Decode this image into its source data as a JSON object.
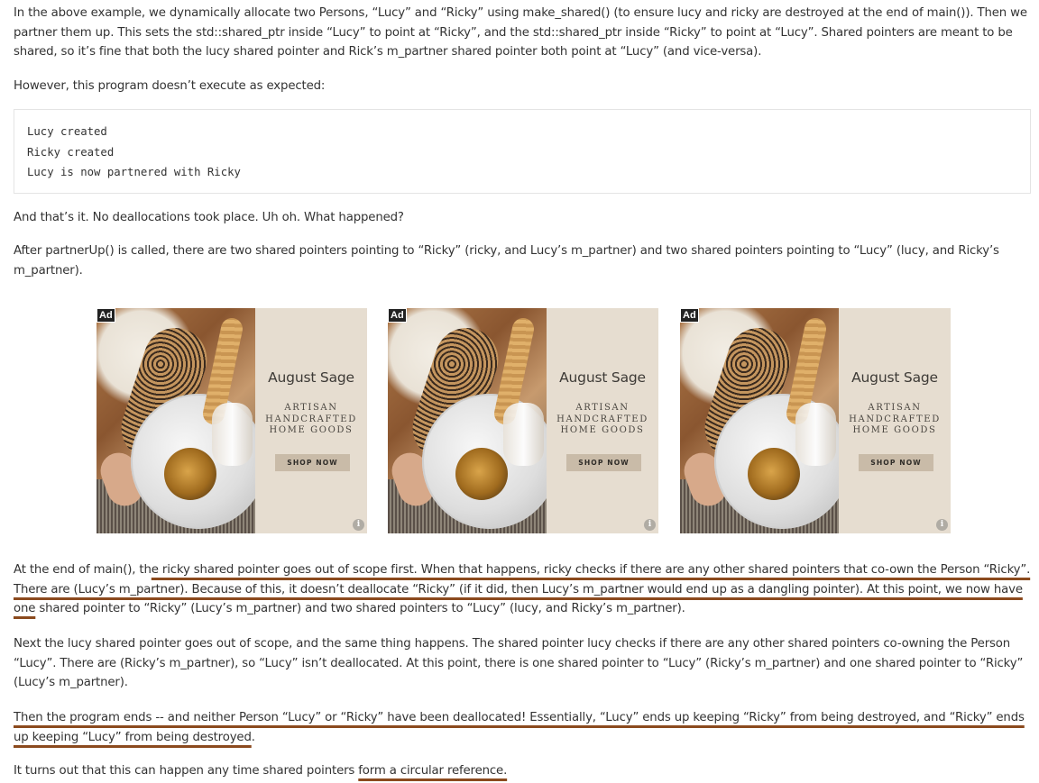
{
  "paragraphs": {
    "p1": "In the above example, we dynamically allocate two Persons, “Lucy” and “Ricky” using make_shared() (to ensure lucy and ricky are destroyed at the end of main()). Then we partner them up. This sets the std::shared_ptr inside “Lucy” to point at “Ricky”, and the std::shared_ptr inside “Ricky” to point at “Lucy”. Shared pointers are meant to be shared, so it’s fine that both the lucy shared pointer and Rick’s m_partner shared pointer both point at “Lucy” (and vice-versa).",
    "p2": "However, this program doesn’t execute as expected:",
    "p3": "And that’s it. No deallocations took place. Uh oh. What happened?",
    "p4": "After partnerUp() is called, there are two shared pointers pointing to “Ricky” (ricky, and Lucy’s m_partner) and two shared pointers pointing to “Lucy” (lucy, and Ricky’s m_partner).",
    "p5_a": "At the end of main(), th",
    "p5_b": "e ricky shared pointer goes out of scope first. When that happens, ricky checks if there are any other shared pointers that co-own the Person “Ricky”. There are (Lucy’s m_partner). Because of this, it doesn’t deallocate “Ricky” (if it did, then Lucy’s m_partner would end up as a dangling pointer). At this point, we now have one",
    "p5_c": " shared pointer to “Ricky” (Lucy’s m_partner) and two shared pointers to “Lucy” (lucy, and Ricky’s m_partner).",
    "p6": "Next the lucy shared pointer goes out of scope, and the same thing happens. The shared pointer lucy checks if there are any other shared pointers co-owning the Person “Lucy”. There are (Ricky’s m_partner), so “Lucy” isn’t deallocated. At this point, there is one shared pointer to “Lucy” (Ricky’s m_partner) and one shared pointer to “Ricky” (Lucy’s m_partner).",
    "p7_a": "Then the program ends -- and neither Person “Lucy” or “Ricky” have been deallocated! Essentially, “Lucy” ends up keeping “Ricky” from being destroyed, and “Ricky” ends up keeping “Lucy” from being destroyed",
    "p7_b": ".",
    "p8_a": "It turns out that this can happen any time shared pointers ",
    "p8_b": "form a circular reference."
  },
  "code_output": "Lucy created\nRicky created\nLucy is now partnered with Ricky",
  "ads": [
    {
      "badge": "Ad",
      "brand": "August Sage",
      "tag_line1": "ARTISAN",
      "tag_line2": "HANDCRAFTED",
      "tag_line3": "HOME GOODS",
      "button": "SHOP NOW",
      "info": "i"
    },
    {
      "badge": "Ad",
      "brand": "August Sage",
      "tag_line1": "ARTISAN",
      "tag_line2": "HANDCRAFTED",
      "tag_line3": "HOME GOODS",
      "button": "SHOP NOW",
      "info": "i"
    },
    {
      "badge": "Ad",
      "brand": "August Sage",
      "tag_line1": "ARTISAN",
      "tag_line2": "HANDCRAFTED",
      "tag_line3": "HOME GOODS",
      "button": "SHOP NOW",
      "info": "i"
    }
  ],
  "colors": {
    "underline": "#8b4a1e",
    "text": "#333333",
    "ad_panel": "#e6ddd0"
  }
}
